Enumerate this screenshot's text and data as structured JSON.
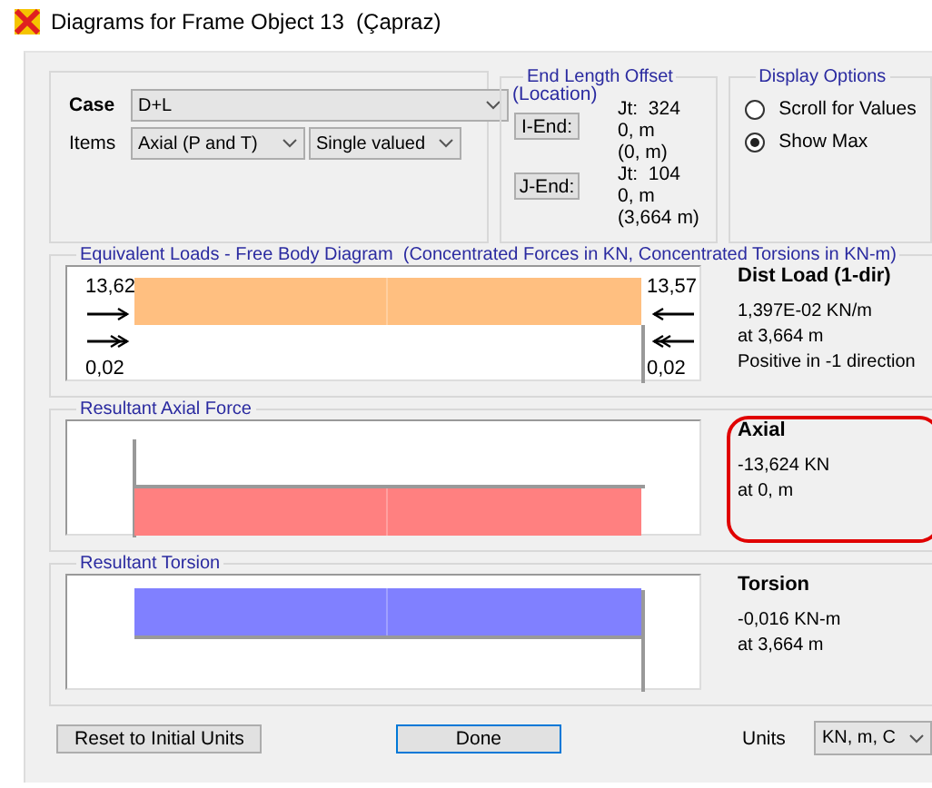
{
  "window": {
    "title": "Diagrams for Frame Object 13  (Çapraz)"
  },
  "case_group": {
    "case_label": "Case",
    "case_value": "D+L",
    "items_label": "Items",
    "items_value": "Axial (P and T)",
    "valued_value": "Single valued"
  },
  "end_offset": {
    "title": "End Length Offset",
    "subtitle": "(Location)",
    "ends": [
      {
        "button": "I-End:",
        "jt": "Jt:  324",
        "offset": "0, m",
        "location": "(0, m)"
      },
      {
        "button": "J-End:",
        "jt": "Jt:  104",
        "offset": "0, m",
        "location": "(3,664 m)"
      }
    ]
  },
  "display_options": {
    "title": "Display Options",
    "options": [
      {
        "label": "Scroll for Values",
        "selected": false
      },
      {
        "label": "Show Max",
        "selected": true
      }
    ]
  },
  "panels": [
    {
      "kind": "loads",
      "title": "Equivalent Loads - Free Body Diagram  (Concentrated Forces in KN, Concentrated Torsions in KN-m)",
      "color": "#ffbf80",
      "end_labels": [
        "13,62",
        "13,57",
        "0,02",
        "0,02"
      ],
      "heading": "Dist Load (1-dir)",
      "lines": [
        "1,397E-02 KN/m",
        "at 3,664 m",
        "Positive in -1 direction"
      ],
      "highlighted": false
    },
    {
      "kind": "axial",
      "title": "Resultant Axial Force",
      "color": "#ff8080",
      "heading": "Axial",
      "lines": [
        "-13,624 KN",
        "at 0, m"
      ],
      "highlighted": true
    },
    {
      "kind": "torsion",
      "title": "Resultant Torsion",
      "color": "#8080ff",
      "heading": "Torsion",
      "lines": [
        "-0,016 KN-m",
        "at 3,664 m"
      ],
      "highlighted": false
    }
  ],
  "bottom": {
    "reset": "Reset to Initial Units",
    "done": "Done",
    "units_label": "Units",
    "units_value": "KN, m, C"
  }
}
